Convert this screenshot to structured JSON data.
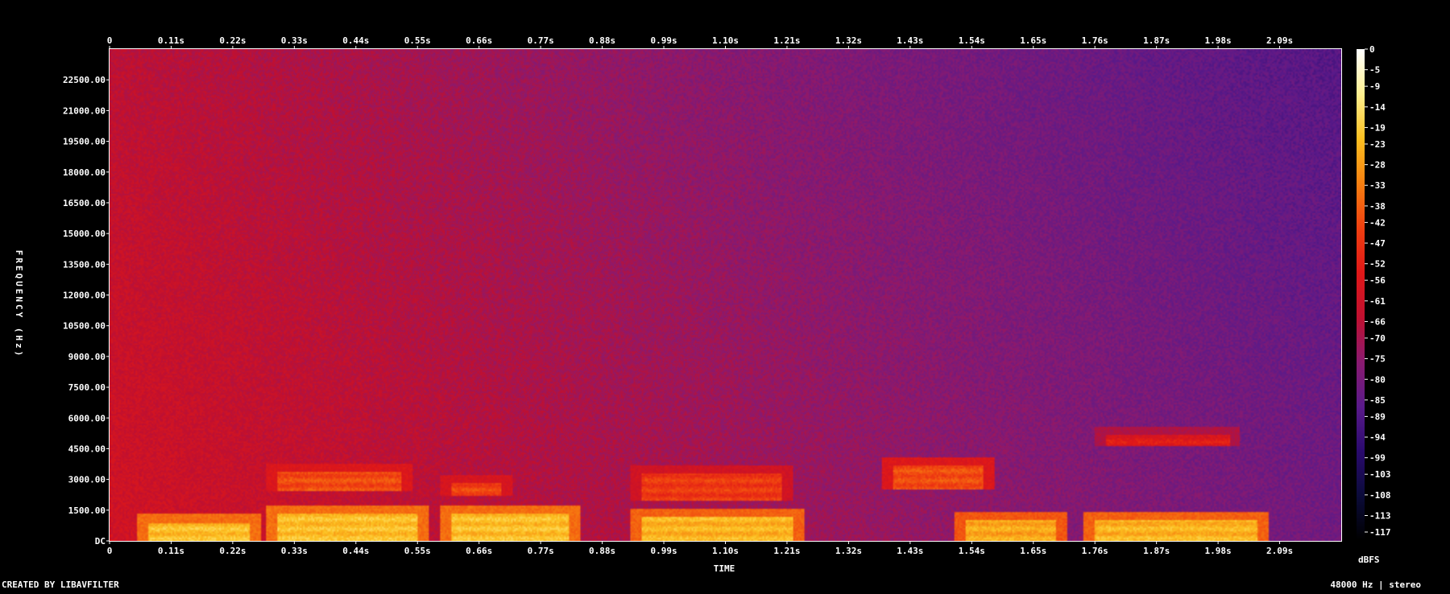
{
  "chart_data": {
    "type": "heatmap",
    "xlabel": "TIME",
    "ylabel": "FREQUENCY (Hz)",
    "x_ticks": [
      "0",
      "0.11s",
      "0.22s",
      "0.33s",
      "0.44s",
      "0.55s",
      "0.66s",
      "0.77s",
      "0.88s",
      "0.99s",
      "1.10s",
      "1.21s",
      "1.32s",
      "1.43s",
      "1.54s",
      "1.65s",
      "1.76s",
      "1.87s",
      "1.98s",
      "2.09s"
    ],
    "x_tick_values": [
      0,
      0.11,
      0.22,
      0.33,
      0.44,
      0.55,
      0.66,
      0.77,
      0.88,
      0.99,
      1.1,
      1.21,
      1.32,
      1.43,
      1.54,
      1.65,
      1.76,
      1.87,
      1.98,
      2.09
    ],
    "xlim": [
      0,
      2.2
    ],
    "y_ticks": [
      "DC",
      "1500.00",
      "3000.00",
      "4500.00",
      "6000.00",
      "7500.00",
      "9000.00",
      "10500.00",
      "12000.00",
      "13500.00",
      "15000.00",
      "16500.00",
      "18000.00",
      "19500.00",
      "21000.00",
      "22500.00"
    ],
    "y_tick_values": [
      0,
      1500,
      3000,
      4500,
      6000,
      7500,
      9000,
      10500,
      12000,
      13500,
      15000,
      16500,
      18000,
      19500,
      21000,
      22500
    ],
    "ylim": [
      0,
      24000
    ],
    "colorbar": {
      "unit": "dBFS",
      "ticks": [
        "0",
        "-5",
        "-9",
        "-14",
        "-19",
        "-23",
        "-28",
        "-33",
        "-38",
        "-42",
        "-47",
        "-52",
        "-56",
        "-61",
        "-66",
        "-70",
        "-75",
        "-80",
        "-85",
        "-89",
        "-94",
        "-99",
        "-103",
        "-108",
        "-113",
        "-117"
      ],
      "tick_values": [
        0,
        -5,
        -9,
        -14,
        -19,
        -23,
        -28,
        -33,
        -38,
        -42,
        -47,
        -52,
        -56,
        -61,
        -66,
        -70,
        -75,
        -80,
        -85,
        -89,
        -94,
        -99,
        -103,
        -108,
        -113,
        -117
      ],
      "range": [
        -120,
        0
      ],
      "colors": [
        "#000000",
        "#0b0b3a",
        "#2a0a6e",
        "#5a1a8a",
        "#8a1a70",
        "#c01030",
        "#e01818",
        "#f04010",
        "#f78010",
        "#fcc020",
        "#fff090",
        "#ffffff"
      ]
    },
    "energy_regions": [
      {
        "t0": 0.07,
        "t1": 0.25,
        "f0": 0,
        "f1": 900,
        "db": -22
      },
      {
        "t0": 0.3,
        "t1": 0.55,
        "f0": 0,
        "f1": 1300,
        "db": -22
      },
      {
        "t0": 0.3,
        "t1": 0.52,
        "f0": 2400,
        "f1": 3400,
        "db": -42
      },
      {
        "t0": 0.61,
        "t1": 0.82,
        "f0": 0,
        "f1": 1300,
        "db": -22
      },
      {
        "t0": 0.61,
        "t1": 0.7,
        "f0": 2200,
        "f1": 2800,
        "db": -44
      },
      {
        "t0": 0.95,
        "t1": 1.22,
        "f0": 0,
        "f1": 1200,
        "db": -24
      },
      {
        "t0": 0.95,
        "t1": 1.2,
        "f0": 2000,
        "f1": 3300,
        "db": -46
      },
      {
        "t0": 1.4,
        "t1": 1.56,
        "f0": 2500,
        "f1": 3700,
        "db": -42
      },
      {
        "t0": 1.53,
        "t1": 1.69,
        "f0": 0,
        "f1": 1000,
        "db": -26
      },
      {
        "t0": 1.76,
        "t1": 2.05,
        "f0": 0,
        "f1": 1000,
        "db": -24
      },
      {
        "t0": 1.78,
        "t1": 2.0,
        "f0": 4600,
        "f1": 5200,
        "db": -55
      }
    ]
  },
  "footer": {
    "left": "CREATED BY LIBAVFILTER",
    "right": "48000 Hz | stereo"
  }
}
